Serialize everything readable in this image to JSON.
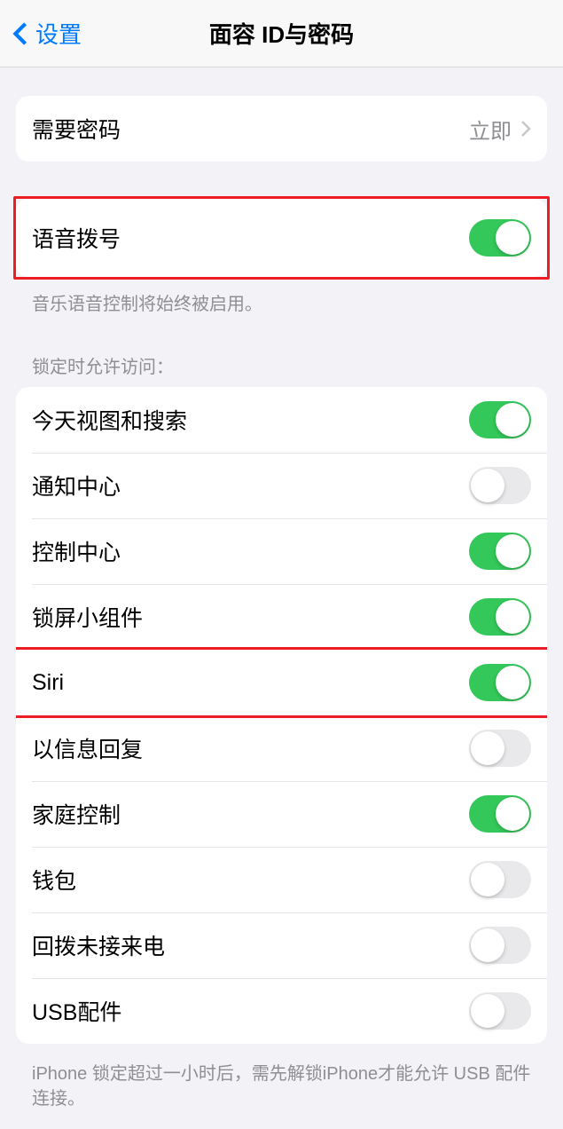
{
  "nav": {
    "back": "设置",
    "title": "面容 ID与密码"
  },
  "passcodeRow": {
    "label": "需要密码",
    "value": "立即"
  },
  "voiceDial": {
    "label": "语音拨号",
    "on": true,
    "footer": "音乐语音控制将始终被启用。"
  },
  "lockAccess": {
    "header": "锁定时允许访问：",
    "items": [
      {
        "label": "今天视图和搜索",
        "on": true
      },
      {
        "label": "通知中心",
        "on": false
      },
      {
        "label": "控制中心",
        "on": true
      },
      {
        "label": "锁屏小组件",
        "on": true
      },
      {
        "label": "Siri",
        "on": true
      },
      {
        "label": "以信息回复",
        "on": false
      },
      {
        "label": "家庭控制",
        "on": true
      },
      {
        "label": "钱包",
        "on": false
      },
      {
        "label": "回拨未接来电",
        "on": false
      },
      {
        "label": "USB配件",
        "on": false
      }
    ],
    "footer": "iPhone 锁定超过一小时后，需先解锁iPhone才能允许 USB 配件连接。"
  }
}
